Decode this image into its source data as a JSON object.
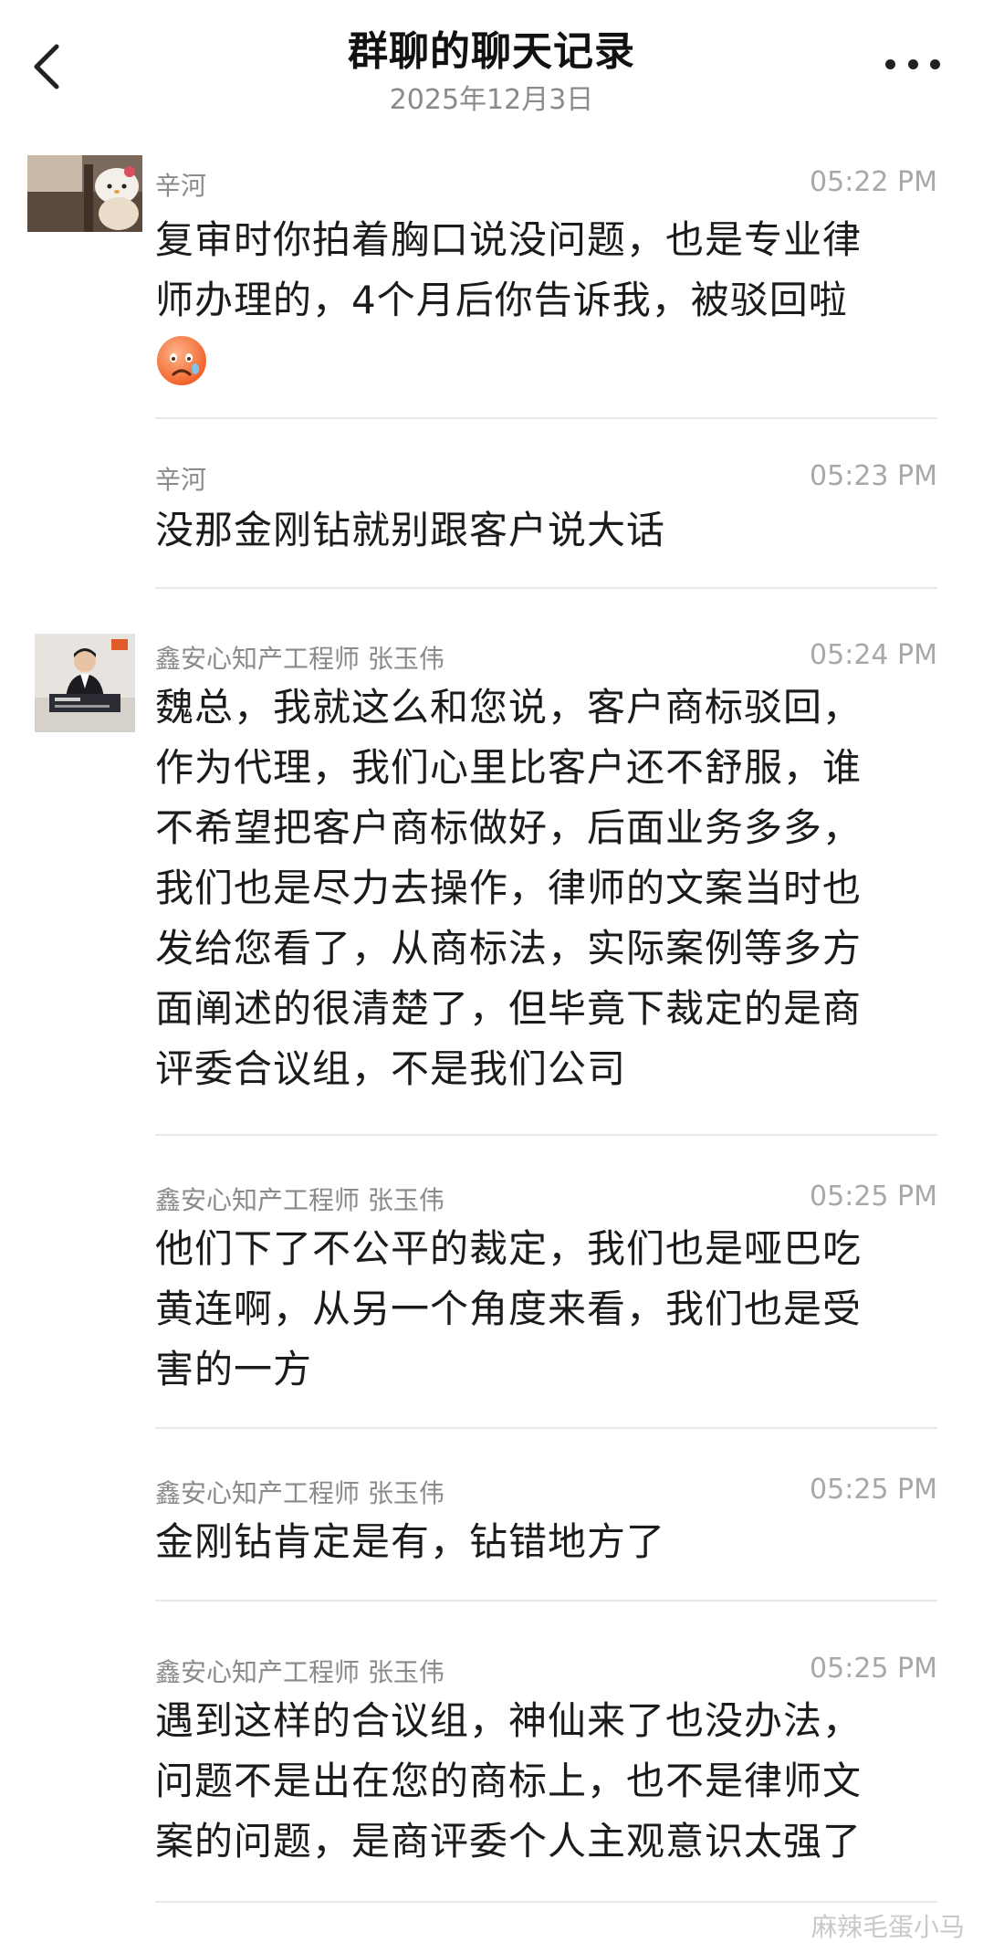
{
  "header": {
    "title": "群聊的聊天记录",
    "date": "2025年12月3日",
    "back_icon": "chevron-left-icon",
    "more_icon": "more-horizontal-icon"
  },
  "messages": [
    {
      "sender": "辛河",
      "time": "05:22 PM",
      "lines": [
        "复审时你拍着胸口说没问题，也是专业律",
        "师办理的，4个月后你告诉我，被驳回啦"
      ],
      "emoji": "sad-face-emoji"
    },
    {
      "sender": "辛河",
      "time": "05:23 PM",
      "lines": [
        "没那金刚钻就别跟客户说大话"
      ]
    },
    {
      "sender": "鑫安心知产工程师 张玉伟",
      "time": "05:24 PM",
      "lines": [
        "魏总，我就这么和您说，客户商标驳回，",
        "作为代理，我们心里比客户还不舒服，谁",
        "不希望把客户商标做好，后面业务多多，",
        "我们也是尽力去操作，律师的文案当时也",
        "发给您看了，从商标法，实际案例等多方",
        "面阐述的很清楚了，但毕竟下裁定的是商",
        "评委合议组，不是我们公司"
      ]
    },
    {
      "sender": "鑫安心知产工程师 张玉伟",
      "time": "05:25 PM",
      "lines": [
        "他们下了不公平的裁定，我们也是哑巴吃",
        "黄连啊，从另一个角度来看，我们也是受",
        "害的一方"
      ]
    },
    {
      "sender": "鑫安心知产工程师 张玉伟",
      "time": "05:25 PM",
      "lines": [
        "金刚钻肯定是有，钻错地方了"
      ]
    },
    {
      "sender": "鑫安心知产工程师 张玉伟",
      "time": "05:25 PM",
      "lines": [
        "遇到这样的合议组，神仙来了也没办法，",
        "问题不是出在您的商标上，也不是律师文",
        "案的问题，是商评委个人主观意识太强了"
      ]
    }
  ],
  "watermark": "麻辣毛蛋小马"
}
